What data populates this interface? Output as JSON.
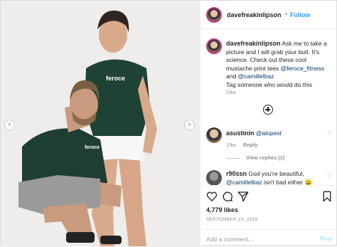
{
  "header": {
    "username": "davefreakinlipson",
    "separator": "•",
    "follow_label": "Follow"
  },
  "photo": {
    "description_icon": "photo-of-two-people",
    "shirt_text": "feroce",
    "prev_arrow": "‹",
    "next_arrow": "›"
  },
  "caption": {
    "username": "davefreakinlipson",
    "text_1": " Ask me to take a picture and I will grab your butt. It's science. Check out these cool mustache print tees ",
    "mention_1": "@feroce_fitness",
    "text_2": " and ",
    "mention_2": "@camillelbaz",
    "text_3": "Tag someone who would do this",
    "time": "19w"
  },
  "comments": [
    {
      "username": "asustinin",
      "mention": "@alopest",
      "time": "19w",
      "reply_label": "Reply",
      "view_replies": "View replies (1)"
    },
    {
      "username": "r90ssn",
      "text_1": " God you're beautiful, ",
      "mention": "@camillelbaz",
      "text_2": " isn't bad either ",
      "emoji": "😄"
    }
  ],
  "actions": {
    "likes": "4,779 likes",
    "date": "SEPTEMBER 10, 2019"
  },
  "add_comment": {
    "placeholder": "Add a comment...",
    "post_label": "Post"
  }
}
